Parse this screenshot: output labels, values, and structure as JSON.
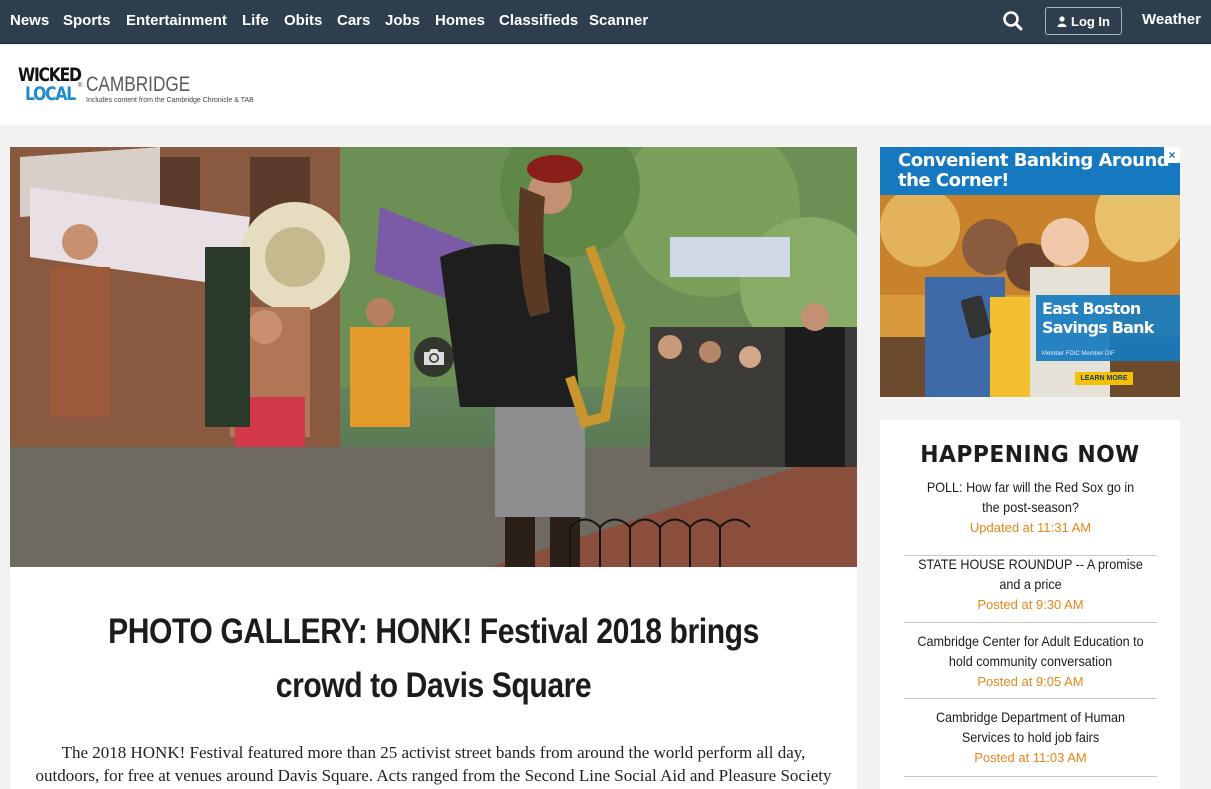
{
  "nav": {
    "items": [
      "News",
      "Sports",
      "Entertainment",
      "Life",
      "Obits",
      "Cars",
      "Jobs",
      "Homes",
      "Classifieds",
      "Scanner"
    ],
    "login_label": "Log In",
    "weather_label": "Weather",
    "icons": [
      "search-icon",
      "user-icon"
    ]
  },
  "logo": {
    "wicked": "WICKED",
    "local": "LOCAL",
    "city": "CAMBRIDGE",
    "tagline": "Includes content from the Cambridge Chronicle & TAB"
  },
  "article": {
    "headline": "PHOTO GALLERY: HONK! Festival 2018 brings crowd to Davis Square",
    "lede": "The 2018 HONK! Festival featured more than 25 activist street bands from around the world perform all day, outdoors, for free at venues around Davis Square. Acts ranged from the Second Line Social Aid and Pleasure Society",
    "photo_icon": "camera-icon"
  },
  "ad": {
    "title": "Convenient Banking Around the Corner!",
    "bank_name": "East Boston Savings Bank",
    "fdic": "Member FDIC Member DIF",
    "cta": "LEARN MORE",
    "close_label": "×"
  },
  "happening": {
    "title": "HAPPENING NOW",
    "items": [
      {
        "headline": "POLL: How far will the Red Sox go in the post-season?",
        "time": "Updated at 11:31 AM"
      },
      {
        "headline": "STATE HOUSE ROUNDUP -- A promise and a price",
        "time": "Posted at 9:30 AM"
      },
      {
        "headline": "Cambridge Center for Adult Education to hold community conversation",
        "time": "Posted at 9:05 AM"
      },
      {
        "headline": "Cambridge Department of Human Services to hold job fairs",
        "time": "Posted at 11:03 AM"
      }
    ]
  },
  "colors": {
    "nav_bg": "#2f3e4e",
    "accent_blue": "#1679bf",
    "time_orange": "#e8861a"
  }
}
